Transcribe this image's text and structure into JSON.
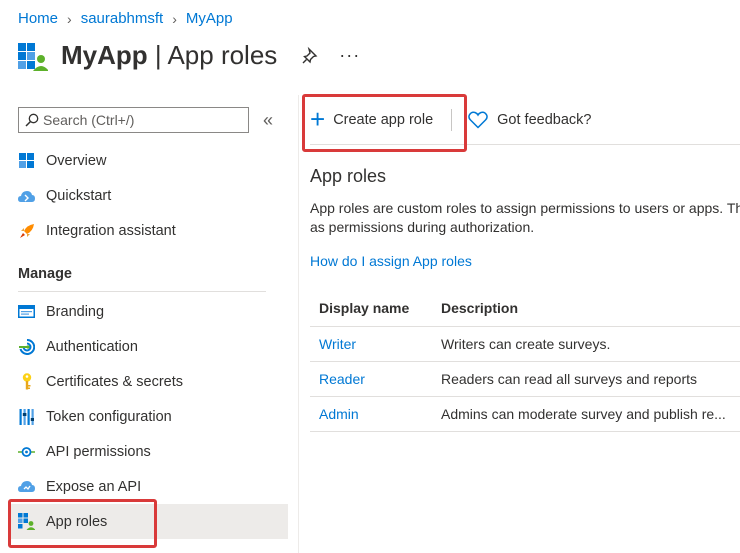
{
  "breadcrumb": [
    "Home",
    "saurabhmsft",
    "MyApp"
  ],
  "header": {
    "app_name": "MyApp",
    "separator": " | ",
    "page_name": "App roles"
  },
  "sidebar": {
    "search_placeholder": "Search (Ctrl+/)",
    "collapse_glyph": "«",
    "top_items": [
      {
        "label": "Overview",
        "icon": "overview-icon"
      },
      {
        "label": "Quickstart",
        "icon": "quickstart-icon"
      },
      {
        "label": "Integration assistant",
        "icon": "rocket-icon"
      }
    ],
    "section_title": "Manage",
    "manage_items": [
      {
        "label": "Branding",
        "icon": "branding-icon"
      },
      {
        "label": "Authentication",
        "icon": "authentication-icon"
      },
      {
        "label": "Certificates & secrets",
        "icon": "key-icon"
      },
      {
        "label": "Token configuration",
        "icon": "token-icon"
      },
      {
        "label": "API permissions",
        "icon": "api-permissions-icon"
      },
      {
        "label": "Expose an API",
        "icon": "cloud-icon"
      },
      {
        "label": "App roles",
        "icon": "app-roles-icon",
        "active": true
      }
    ]
  },
  "toolbar": {
    "create_label": "Create app role",
    "feedback_label": "Got feedback?"
  },
  "content": {
    "title": "App roles",
    "description_line1": "App roles are custom roles to assign permissions to users or apps. Th",
    "description_line2": "as permissions during authorization.",
    "help_link": "How do I assign App roles",
    "table": {
      "headers": [
        "Display name",
        "Description"
      ],
      "rows": [
        {
          "name": "Writer",
          "description": "Writers can create surveys."
        },
        {
          "name": "Reader",
          "description": "Readers can read all surveys and reports"
        },
        {
          "name": "Admin",
          "description": "Admins can moderate survey and publish re..."
        }
      ]
    }
  },
  "colors": {
    "accent": "#0078d4",
    "highlight": "#d93a3a",
    "active_bg": "#edebe9"
  }
}
